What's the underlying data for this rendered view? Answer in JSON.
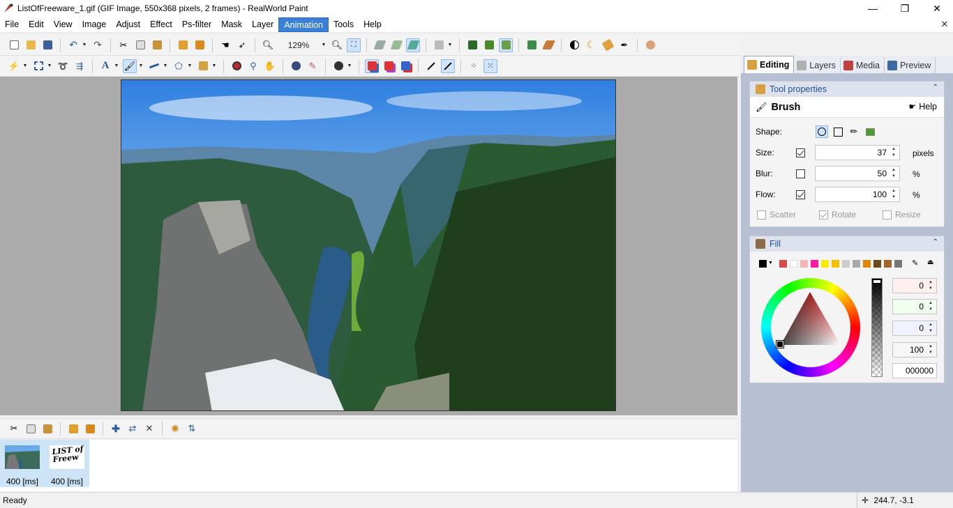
{
  "window": {
    "title": "ListOfFreeware_1.gif (GIF Image, 550x368 pixels, 2 frames) - RealWorld Paint",
    "minimize": "—",
    "maximize": "❐",
    "close": "✕"
  },
  "menu": {
    "items": [
      "File",
      "Edit",
      "View",
      "Image",
      "Adjust",
      "Effect",
      "Ps-filter",
      "Mask",
      "Layer",
      "Animation",
      "Tools",
      "Help"
    ],
    "active": "Animation",
    "close_doc": "✕"
  },
  "toolbar": {
    "zoom": "129%"
  },
  "panel": {
    "tabs": [
      {
        "label": "Editing",
        "icon": "wrench-icon",
        "active": true
      },
      {
        "label": "Layers",
        "icon": "layers-icon"
      },
      {
        "label": "Media",
        "icon": "media-icon"
      },
      {
        "label": "Preview",
        "icon": "film-icon"
      }
    ],
    "tool_properties": {
      "header": "Tool properties",
      "tool_name": "Brush",
      "help": "Help",
      "shape_label": "Shape:",
      "size_label": "Size:",
      "size_value": "37",
      "size_unit": "pixels",
      "blur_label": "Blur:",
      "blur_value": "50",
      "blur_unit": "%",
      "flow_label": "Flow:",
      "flow_value": "100",
      "flow_unit": "%",
      "scatter": "Scatter",
      "rotate": "Rotate",
      "resize": "Resize"
    },
    "fill": {
      "header": "Fill",
      "r": "0",
      "g": "0",
      "b": "0",
      "a": "100",
      "hex": "000000",
      "swatches": [
        "#000000",
        "#d94b4b",
        "#ffffff",
        "#f4b6b6",
        "#ff1aa0",
        "#f7ea00",
        "#f2c000",
        "#cccccc",
        "#a9a9a9",
        "#e08800",
        "#6a4a1d",
        "#a0652a",
        "#777777"
      ]
    }
  },
  "frames": [
    {
      "label": "400 [ms]"
    },
    {
      "label": "400 [ms]",
      "art_text": "LIST of Freew"
    }
  ],
  "status": {
    "text": "Ready",
    "coords": "244.7, -3.1"
  }
}
